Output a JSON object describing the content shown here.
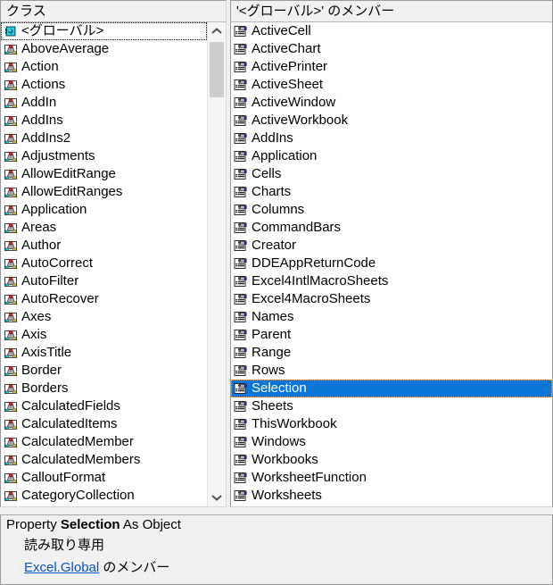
{
  "window": {
    "kind": "object-browser"
  },
  "left_pane": {
    "header": "クラス",
    "items": [
      {
        "label": "<グローバル>",
        "icon": "global-icon",
        "focused": true
      },
      {
        "label": "AboveAverage",
        "icon": "class-icon"
      },
      {
        "label": "Action",
        "icon": "class-icon"
      },
      {
        "label": "Actions",
        "icon": "class-icon"
      },
      {
        "label": "AddIn",
        "icon": "class-icon"
      },
      {
        "label": "AddIns",
        "icon": "class-icon"
      },
      {
        "label": "AddIns2",
        "icon": "class-icon"
      },
      {
        "label": "Adjustments",
        "icon": "class-icon"
      },
      {
        "label": "AllowEditRange",
        "icon": "class-icon"
      },
      {
        "label": "AllowEditRanges",
        "icon": "class-icon"
      },
      {
        "label": "Application",
        "icon": "class-icon"
      },
      {
        "label": "Areas",
        "icon": "class-icon"
      },
      {
        "label": "Author",
        "icon": "class-icon"
      },
      {
        "label": "AutoCorrect",
        "icon": "class-icon"
      },
      {
        "label": "AutoFilter",
        "icon": "class-icon"
      },
      {
        "label": "AutoRecover",
        "icon": "class-icon"
      },
      {
        "label": "Axes",
        "icon": "class-icon"
      },
      {
        "label": "Axis",
        "icon": "class-icon"
      },
      {
        "label": "AxisTitle",
        "icon": "class-icon"
      },
      {
        "label": "Border",
        "icon": "class-icon"
      },
      {
        "label": "Borders",
        "icon": "class-icon"
      },
      {
        "label": "CalculatedFields",
        "icon": "class-icon"
      },
      {
        "label": "CalculatedItems",
        "icon": "class-icon"
      },
      {
        "label": "CalculatedMember",
        "icon": "class-icon"
      },
      {
        "label": "CalculatedMembers",
        "icon": "class-icon"
      },
      {
        "label": "CalloutFormat",
        "icon": "class-icon"
      },
      {
        "label": "CategoryCollection",
        "icon": "class-icon"
      }
    ],
    "scrollbar": {
      "up_arrow": "chevron-up-icon",
      "down_arrow": "chevron-down-icon"
    }
  },
  "right_pane": {
    "header": "'<グローバル>' のメンバー",
    "items": [
      {
        "label": "ActiveCell",
        "icon": "property-icon"
      },
      {
        "label": "ActiveChart",
        "icon": "property-icon"
      },
      {
        "label": "ActivePrinter",
        "icon": "property-icon"
      },
      {
        "label": "ActiveSheet",
        "icon": "property-icon"
      },
      {
        "label": "ActiveWindow",
        "icon": "property-icon"
      },
      {
        "label": "ActiveWorkbook",
        "icon": "property-icon"
      },
      {
        "label": "AddIns",
        "icon": "property-icon"
      },
      {
        "label": "Application",
        "icon": "property-icon"
      },
      {
        "label": "Cells",
        "icon": "property-icon"
      },
      {
        "label": "Charts",
        "icon": "property-icon"
      },
      {
        "label": "Columns",
        "icon": "property-icon"
      },
      {
        "label": "CommandBars",
        "icon": "property-icon"
      },
      {
        "label": "Creator",
        "icon": "property-icon"
      },
      {
        "label": "DDEAppReturnCode",
        "icon": "property-icon"
      },
      {
        "label": "Excel4IntlMacroSheets",
        "icon": "property-icon"
      },
      {
        "label": "Excel4MacroSheets",
        "icon": "property-icon"
      },
      {
        "label": "Names",
        "icon": "property-icon"
      },
      {
        "label": "Parent",
        "icon": "property-icon"
      },
      {
        "label": "Range",
        "icon": "property-icon"
      },
      {
        "label": "Rows",
        "icon": "property-icon"
      },
      {
        "label": "Selection",
        "icon": "property-icon",
        "selected": true,
        "focused": true
      },
      {
        "label": "Sheets",
        "icon": "property-icon"
      },
      {
        "label": "ThisWorkbook",
        "icon": "property-icon"
      },
      {
        "label": "Windows",
        "icon": "property-icon"
      },
      {
        "label": "Workbooks",
        "icon": "property-icon"
      },
      {
        "label": "WorksheetFunction",
        "icon": "property-icon"
      },
      {
        "label": "Worksheets",
        "icon": "property-icon"
      }
    ]
  },
  "detail_pane": {
    "signature_prefix": "Property",
    "signature_name": "Selection",
    "signature_suffix": "As Object",
    "readonly_text": "読み取り専用",
    "member_of_link": "Excel.Global",
    "member_of_suffix": "のメンバー"
  },
  "colors": {
    "selection_blue": "#0b76d8",
    "link_blue": "#0b53c4",
    "pane_bg": "#f0f0f0",
    "list_bg": "#ffffff",
    "scroll_thumb": "#cdcdcd"
  }
}
